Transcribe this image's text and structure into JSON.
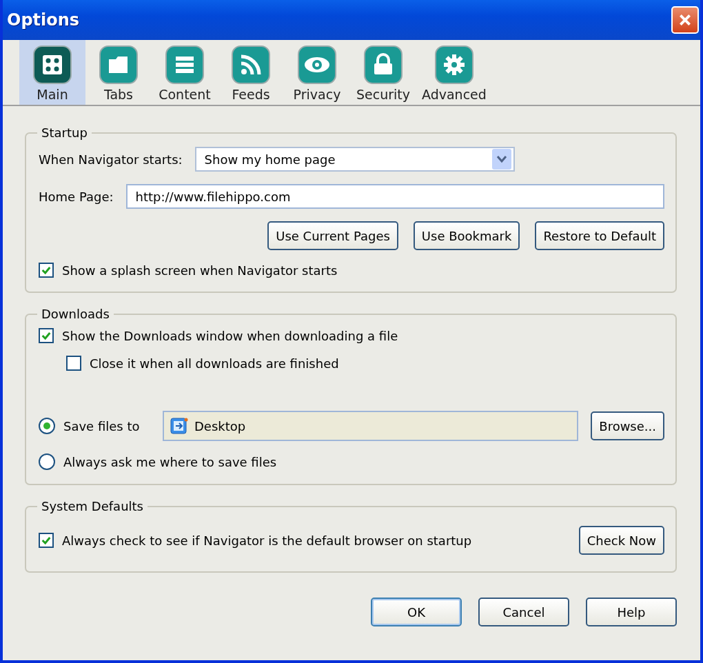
{
  "window": {
    "title": "Options"
  },
  "toolbar": [
    {
      "label": "Main",
      "selected": true
    },
    {
      "label": "Tabs",
      "selected": false
    },
    {
      "label": "Content",
      "selected": false
    },
    {
      "label": "Feeds",
      "selected": false
    },
    {
      "label": "Privacy",
      "selected": false
    },
    {
      "label": "Security",
      "selected": false
    },
    {
      "label": "Advanced",
      "selected": false
    }
  ],
  "startup": {
    "title": "Startup",
    "when_label": "When Navigator starts:",
    "when_value": "Show my home page",
    "home_label": "Home Page:",
    "home_value": "http://www.filehippo.com",
    "buttons": [
      "Use Current Pages",
      "Use Bookmark",
      "Restore to Default"
    ],
    "splash": {
      "label": "Show a splash screen when Navigator starts",
      "checked": true
    }
  },
  "downloads": {
    "title": "Downloads",
    "show_window": {
      "label": "Show the Downloads window when downloading a file",
      "checked": true
    },
    "close_when_done": {
      "label": "Close it when all downloads are finished",
      "checked": false
    },
    "save_options": [
      {
        "label": "Save files to",
        "selected": true
      },
      {
        "label": "Always ask me where to save files",
        "selected": false
      }
    ],
    "folder": "Desktop",
    "browse": "Browse..."
  },
  "system_defaults": {
    "title": "System Defaults",
    "check_default": {
      "label": "Always check to see if Navigator is the default browser on startup",
      "checked": true
    },
    "check_now": "Check Now"
  },
  "buttons": [
    "OK",
    "Cancel",
    "Help"
  ]
}
